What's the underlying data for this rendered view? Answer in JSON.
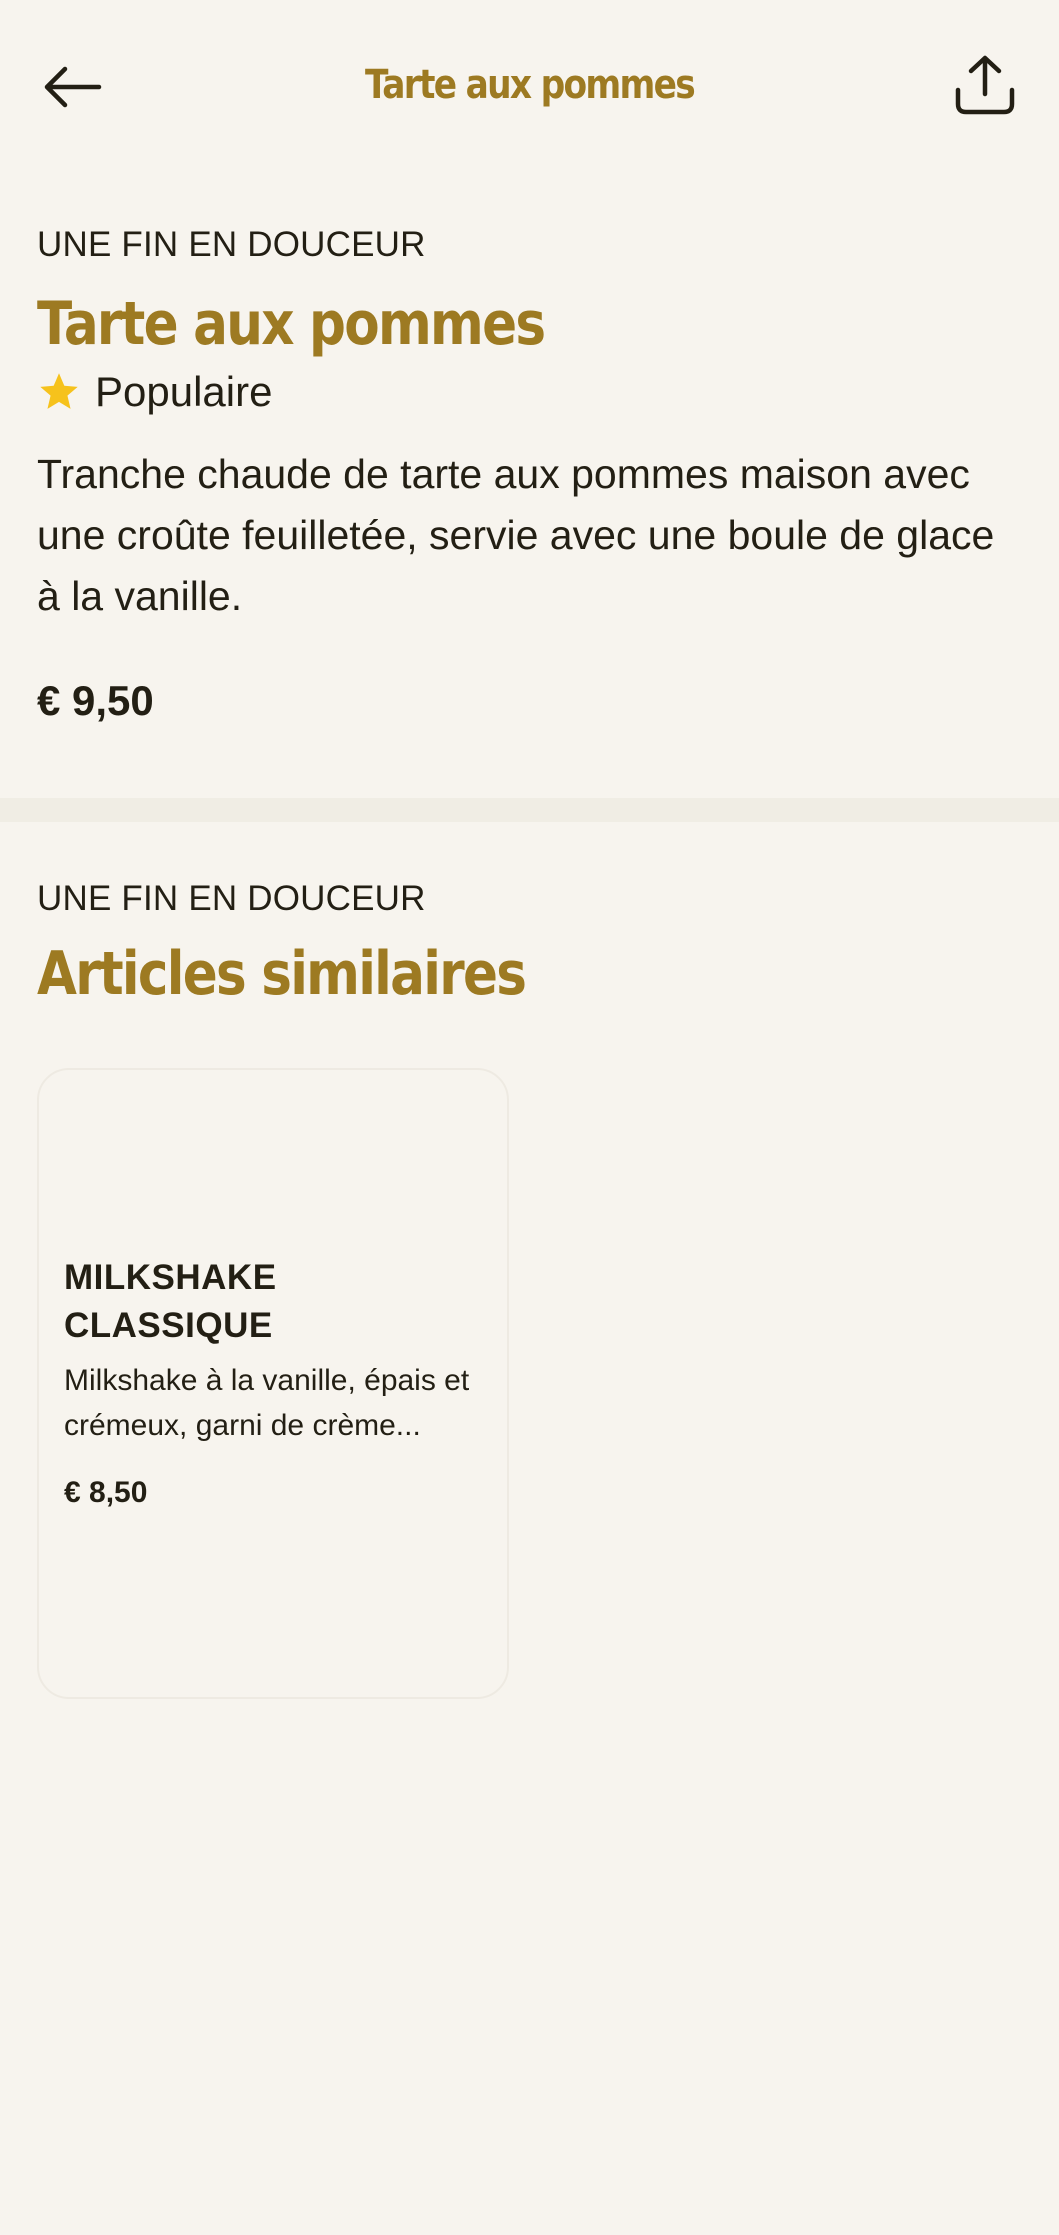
{
  "header": {
    "title": "Tarte aux pommes",
    "back_icon": "arrow-left-icon",
    "share_icon": "share-icon"
  },
  "product": {
    "category": "UNE FIN EN DOUCEUR",
    "name": "Tarte aux pommes",
    "badge_icon": "star-icon",
    "badge_label": "Populaire",
    "description": "Tranche chaude de tarte aux pommes maison avec une croûte feuilletée, servie avec une boule de glace à la vanille.",
    "price": "€ 9,50"
  },
  "similar": {
    "category": "UNE FIN EN DOUCEUR",
    "title": "Articles similaires",
    "items": [
      {
        "name": "MILKSHAKE CLASSIQUE",
        "description": "Milkshake à la vanille, épais et crémeux, garni de crème...",
        "price": "€ 8,50"
      }
    ]
  },
  "colors": {
    "background": "#F7F4EE",
    "accent": "#9D7A22",
    "text": "#231F14",
    "star": "#F6C21C",
    "divider": "#F0EDE4"
  }
}
